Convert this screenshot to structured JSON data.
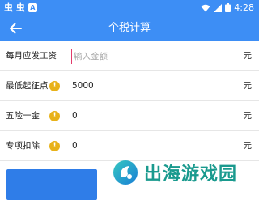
{
  "status_bar": {
    "app_glyphs": "虫 虫",
    "badge": "A",
    "time": "4:28"
  },
  "app_bar": {
    "title": "个税计算"
  },
  "form": {
    "rows": [
      {
        "label": "每月应发工资",
        "placeholder": "输入金额",
        "unit": "元"
      },
      {
        "label": "最低起征点",
        "value": "5000",
        "unit": "元"
      },
      {
        "label": "五险一金",
        "value": "0",
        "unit": "元"
      },
      {
        "label": "专项扣除",
        "value": "0",
        "unit": "元"
      }
    ],
    "info_glyph": "!"
  },
  "watermark": {
    "text": "出海游戏园"
  },
  "colors": {
    "primary": "#3d8ef5",
    "button": "#2f7de8",
    "info": "#e8b21a",
    "watermark": "#1a9a8e"
  }
}
